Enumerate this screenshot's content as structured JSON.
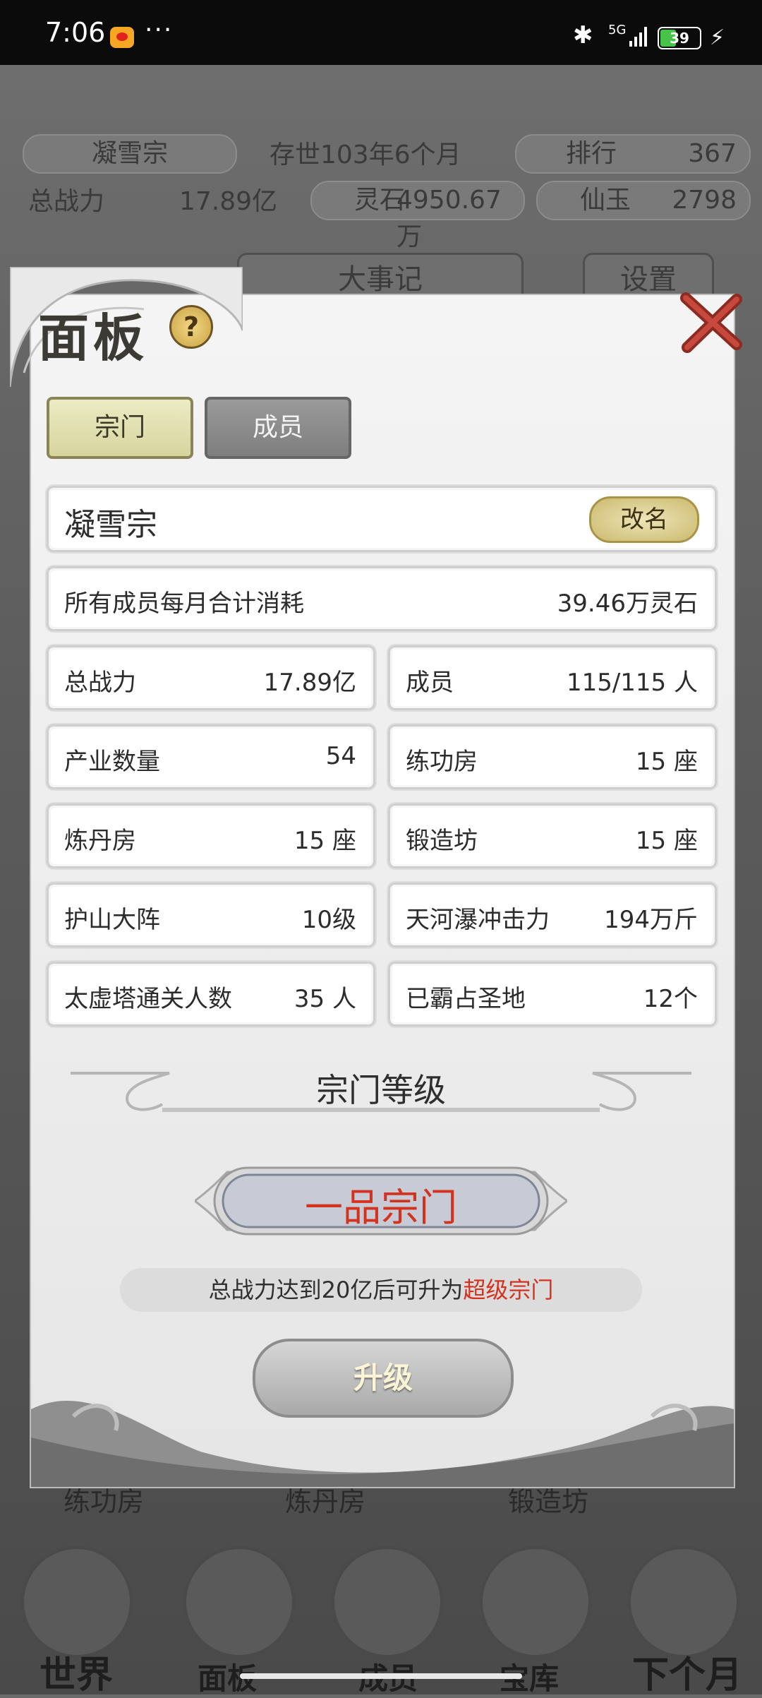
{
  "status_bar": {
    "time": "7:06",
    "more": "···",
    "network": "5G",
    "battery": "39"
  },
  "background": {
    "sect_name": "凝雪宗",
    "age": "存世103年6个月",
    "rank_label": "排行",
    "rank_value": "367",
    "power_label": "总战力",
    "power_value": "17.89亿",
    "spirit_label": "灵石",
    "spirit_value": "4950.67万",
    "jade_label": "仙玉",
    "jade_value": "2798",
    "major_events_tab": "大事记",
    "settings_tab": "设置",
    "row_labels": [
      "练功房",
      "炼丹房",
      "锻造坊"
    ],
    "nav": [
      "世界",
      "面板",
      "成员",
      "宝库",
      "下个月"
    ]
  },
  "panel": {
    "title": "面板",
    "help": "?",
    "tabs": {
      "sect": "宗门",
      "members": "成员"
    },
    "name": "凝雪宗",
    "rename": "改名",
    "monthly_cost": {
      "label": "所有成员每月合计消耗",
      "value": "39.46万灵石"
    },
    "stats": [
      {
        "label": "总战力",
        "value": "17.89亿"
      },
      {
        "label": "成员",
        "value": "115/115 人"
      },
      {
        "label": "产业数量",
        "value": "54"
      },
      {
        "label": "练功房",
        "value": "15 座"
      },
      {
        "label": "炼丹房",
        "value": "15 座"
      },
      {
        "label": "锻造坊",
        "value": "15 座"
      },
      {
        "label": "护山大阵",
        "value": "10级"
      },
      {
        "label": "天河瀑冲击力",
        "value": "194万斤"
      },
      {
        "label": "太虚塔通关人数",
        "value": "35 人"
      },
      {
        "label": "已霸占圣地",
        "value": "12个"
      }
    ],
    "level_section": "宗门等级",
    "current_rank": "一品宗门",
    "hint_prefix": "总战力达到20亿后可升为",
    "hint_target": "超级宗门",
    "upgrade": "升级"
  }
}
